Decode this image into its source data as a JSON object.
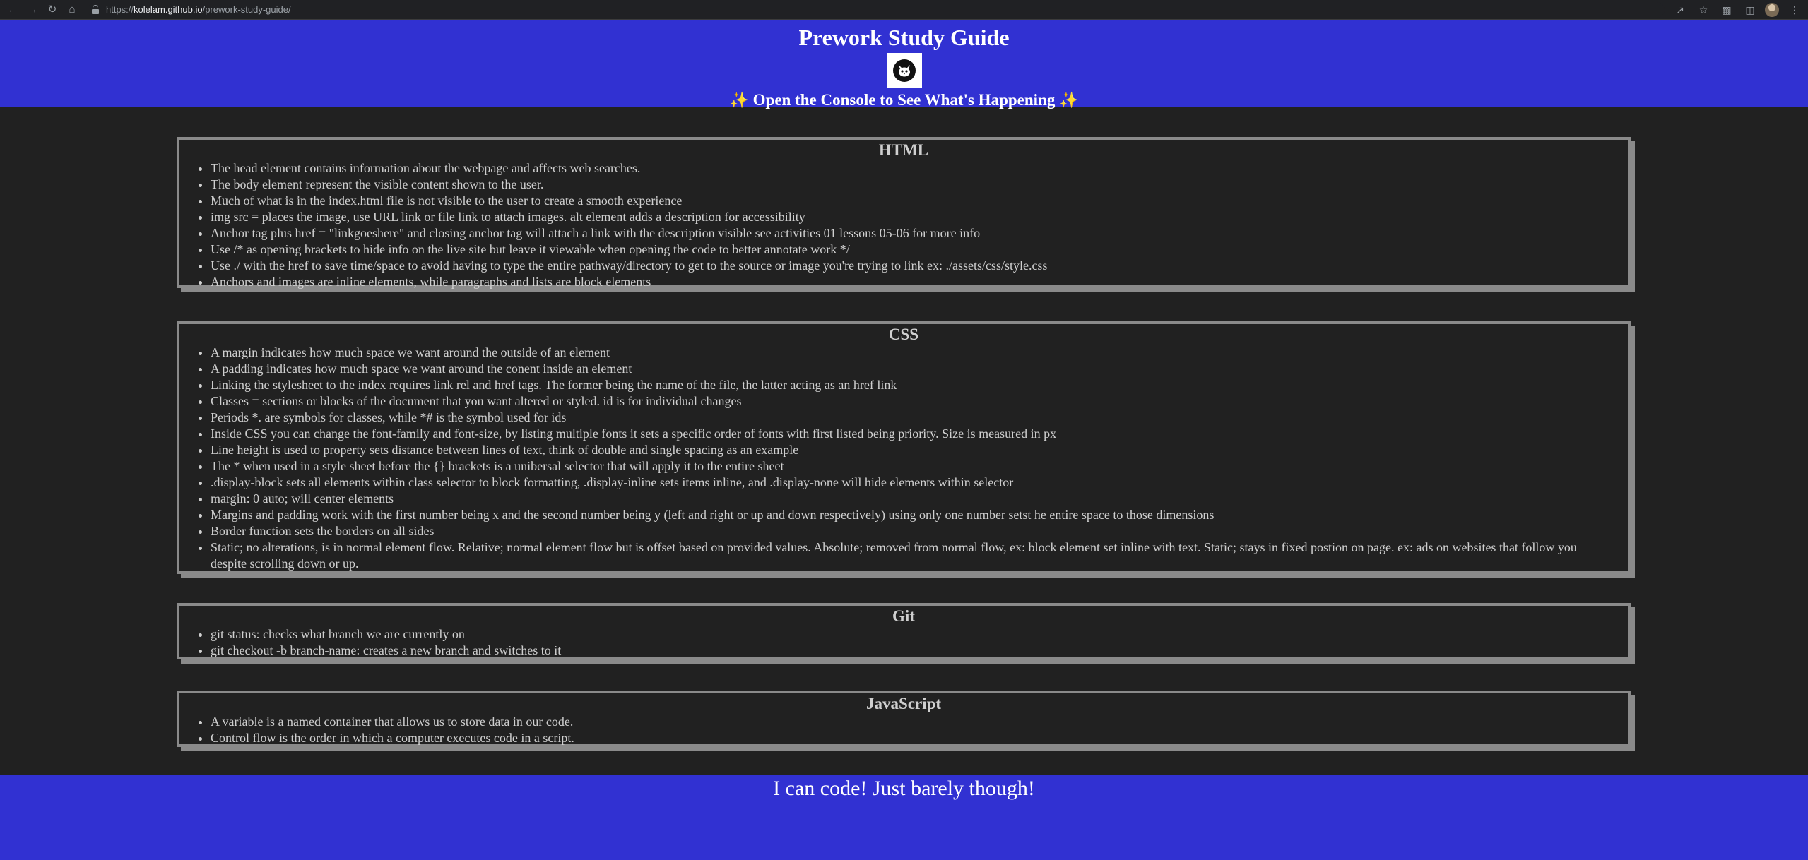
{
  "browser": {
    "url_prefix": "https://",
    "url_host": "kolelam.github.io",
    "url_path": "/prework-study-guide/"
  },
  "header": {
    "title": "Prework Study Guide",
    "subtitle": "Open the Console to See What's Happening"
  },
  "sections": [
    {
      "title": "HTML",
      "items": [
        "The head element contains information about the webpage and affects web searches.",
        "The body element represent the visible content shown to the user.",
        "Much of what is in the index.html file is not visible to the user to create a smooth experience",
        "img src = places the image, use URL link or file link to attach images. alt element adds a description for accessibility",
        "Anchor tag plus href = \"linkgoeshere\" and closing anchor tag will attach a link with the description visible see activities 01 lessons 05-06 for more info",
        "Use /* as opening brackets to hide info on the live site but leave it viewable when opening the code to better annotate work */",
        "Use ./ with the href to save time/space to avoid having to type the entire pathway/directory to get to the source or image you're trying to link ex: ./assets/css/style.css",
        "Anchors and images are inline elements, while paragraphs and lists are block elements"
      ]
    },
    {
      "title": "CSS",
      "items": [
        "A margin indicates how much space we want around the outside of an element",
        "A padding indicates how much space we want around the conent inside an element",
        "Linking the stylesheet to the index requires link rel and href tags. The former being the name of the file, the latter acting as an href link",
        "Classes = sections or blocks of the document that you want altered or styled. id is for individual changes",
        "Periods *. are symbols for classes, while *# is the symbol used for ids",
        "Inside CSS you can change the font-family and font-size, by listing multiple fonts it sets a specific order of fonts with first listed being priority. Size is measured in px",
        "Line height is used to property sets distance between lines of text, think of double and single spacing as an example",
        "The * when used in a style sheet before the {} brackets is a unibersal selector that will apply it to the entire sheet",
        ".display-block sets all elements within class selector to block formatting, .display-inline sets items inline, and .display-none will hide elements within selector",
        "margin: 0 auto; will center elements",
        "Margins and padding work with the first number being x and the second number being y (left and right or up and down respectively) using only one number setst he entire space to those dimensions",
        "Border function sets the borders on all sides",
        "Static; no alterations, is in normal element flow. Relative; normal element flow but is offset based on provided values. Absolute; removed from normal flow, ex: block element set inline with text. Static; stays in fixed postion on page. ex: ads on websites that follow you despite scrolling down or up."
      ]
    },
    {
      "title": "Git",
      "items": [
        "git status: checks what branch we are currently on",
        "git checkout -b branch-name: creates a new branch and switches to it"
      ]
    },
    {
      "title": "JavaScript",
      "items": [
        "A variable is a named container that allows us to store data in our code.",
        "Control flow is the order in which a computer executes code in a script."
      ]
    }
  ],
  "footer": {
    "text": "I can code! Just barely though!"
  }
}
